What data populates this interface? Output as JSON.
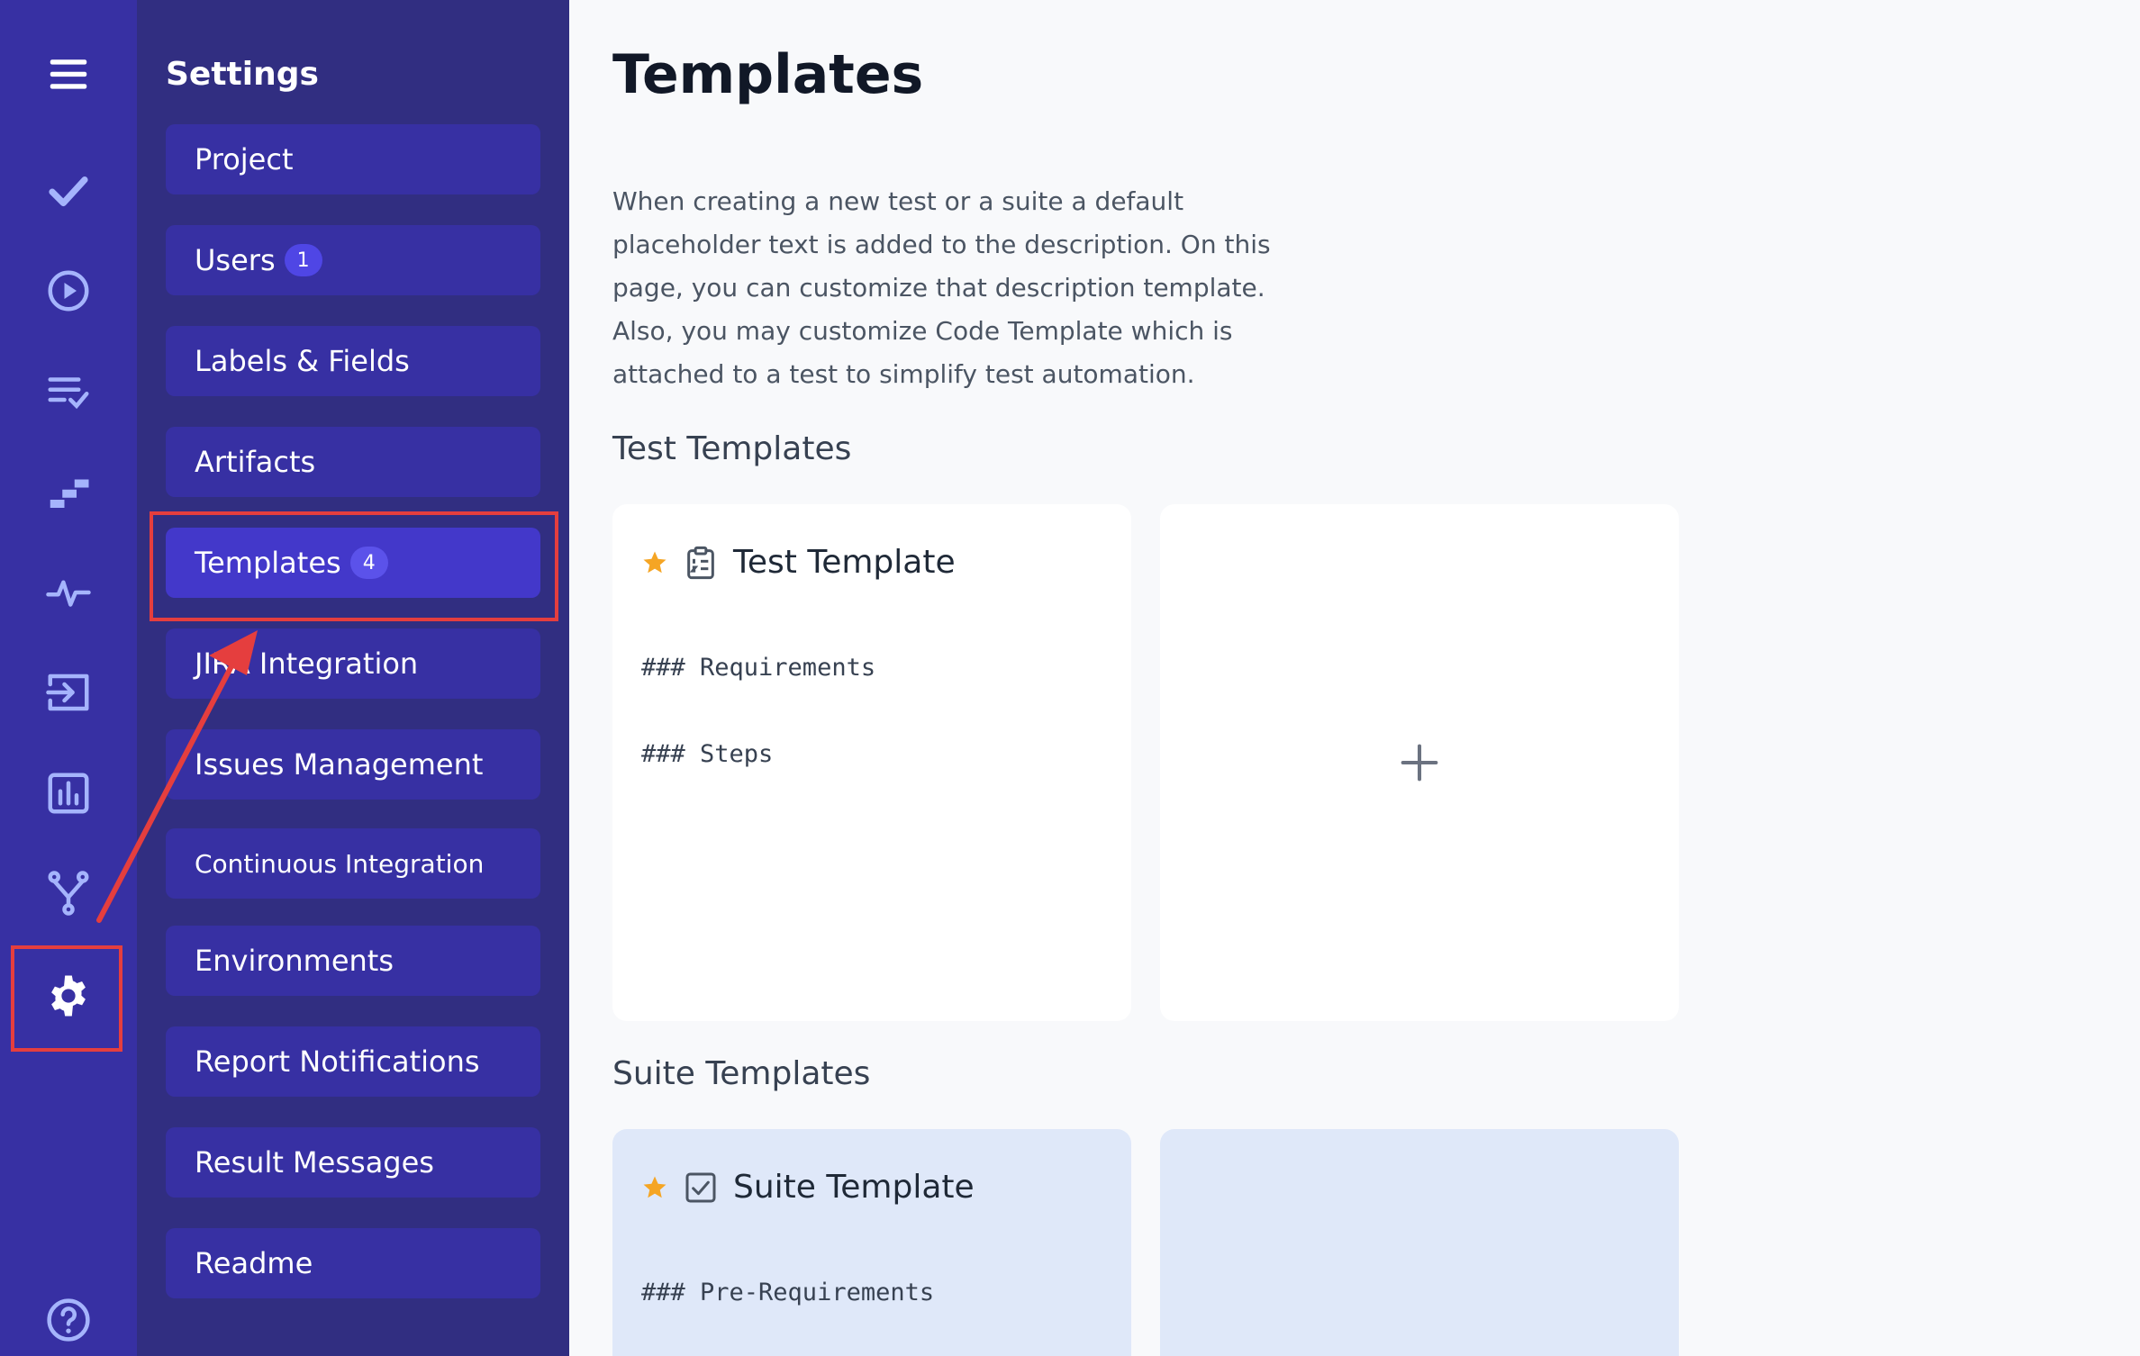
{
  "panel": {
    "title": "Settings",
    "items": [
      {
        "label": "Project",
        "badge": ""
      },
      {
        "label": "Users",
        "badge": "1"
      },
      {
        "label": "Labels & Fields",
        "badge": ""
      },
      {
        "label": "Artifacts",
        "badge": ""
      },
      {
        "label": "Templates",
        "badge": "4"
      },
      {
        "label": "JIRA Integration",
        "badge": ""
      },
      {
        "label": "Issues Management",
        "badge": ""
      },
      {
        "label": "Continuous Integration",
        "badge": ""
      },
      {
        "label": "Environments",
        "badge": ""
      },
      {
        "label": "Report Notifications",
        "badge": ""
      },
      {
        "label": "Result Messages",
        "badge": ""
      },
      {
        "label": "Readme",
        "badge": ""
      }
    ]
  },
  "main": {
    "title": "Templates",
    "description": "When creating a new test or a suite a default placeholder text is added to the description. On this page, you can customize that description template. Also, you may customize Code Template which is attached to a test to simplify test automation.",
    "test_section": "Test Templates",
    "suite_section": "Suite Templates",
    "test_card": {
      "title": "Test Template",
      "lines": [
        "### Requirements",
        "### Steps"
      ]
    },
    "suite_card": {
      "title": "Suite Template",
      "lines": [
        "### Pre-Requirements"
      ]
    }
  },
  "icons": [
    "menu-icon",
    "check-icon",
    "play-icon",
    "checklist-icon",
    "steps-icon",
    "pulse-icon",
    "import-icon",
    "analytics-icon",
    "branch-icon",
    "gear-icon",
    "help-icon",
    "star-icon",
    "clipboard-icon",
    "checkbox-icon",
    "plus-icon"
  ],
  "colors": {
    "rail": "#3730a3",
    "panel": "#312e81",
    "nav_item": "#3730a3",
    "nav_active": "#4338ca",
    "annotation": "#e53e3e",
    "star": "#f5a524"
  }
}
